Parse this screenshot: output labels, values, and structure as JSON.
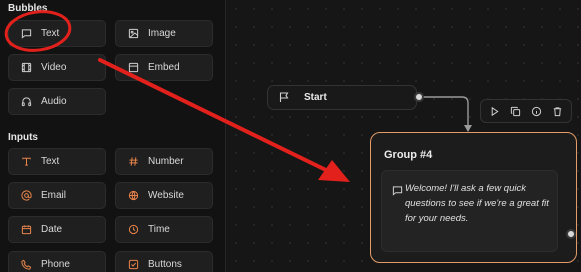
{
  "sidebar": {
    "bubbles_title": "Bubbles",
    "bubbles": [
      {
        "label": "Text",
        "icon": "message-icon"
      },
      {
        "label": "Image",
        "icon": "image-icon"
      },
      {
        "label": "Video",
        "icon": "film-icon"
      },
      {
        "label": "Embed",
        "icon": "embed-icon"
      },
      {
        "label": "Audio",
        "icon": "headphones-icon"
      }
    ],
    "inputs_title": "Inputs",
    "inputs": [
      {
        "label": "Text",
        "icon": "text-input-icon"
      },
      {
        "label": "Number",
        "icon": "hash-icon"
      },
      {
        "label": "Email",
        "icon": "at-icon"
      },
      {
        "label": "Website",
        "icon": "globe-icon"
      },
      {
        "label": "Date",
        "icon": "calendar-icon"
      },
      {
        "label": "Time",
        "icon": "clock-icon"
      },
      {
        "label": "Phone",
        "icon": "phone-icon"
      },
      {
        "label": "Buttons",
        "icon": "checkbox-icon"
      }
    ]
  },
  "canvas": {
    "start_node": {
      "label": "Start",
      "icon": "flag-icon"
    },
    "toolbar": [
      {
        "icon": "play-icon"
      },
      {
        "icon": "copy-icon"
      },
      {
        "icon": "info-icon"
      },
      {
        "icon": "trash-icon"
      }
    ],
    "group": {
      "title": "Group #4",
      "message": "Welcome! I'll ask a few quick questions to see if we're a great fit for your needs.",
      "message_icon": "message-icon"
    }
  },
  "colors": {
    "accent": "#e8844a",
    "group_border": "#e39b67",
    "annotation_red": "#e2211c"
  }
}
